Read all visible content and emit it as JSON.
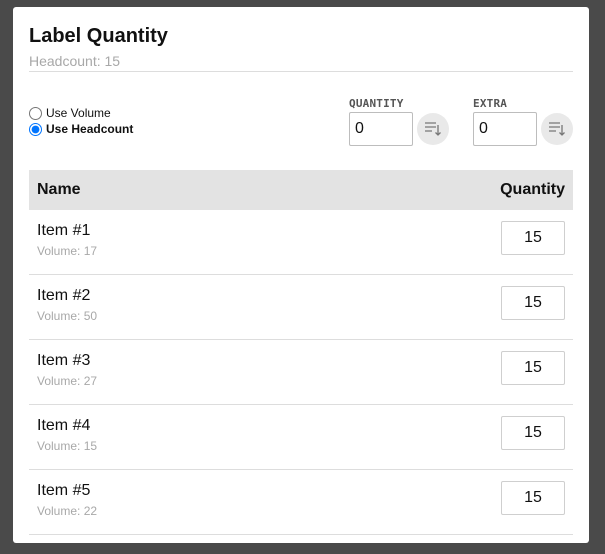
{
  "dialog": {
    "title": "Label Quantity",
    "subtitle": "Headcount: 15"
  },
  "mode": {
    "options": [
      {
        "label": "Use Volume",
        "selected": false
      },
      {
        "label": "Use Headcount",
        "selected": true
      }
    ]
  },
  "fields": {
    "quantity": {
      "label": "QUANTITY",
      "value": "0",
      "icon": "sort-icon"
    },
    "extra": {
      "label": "EXTRA",
      "value": "0",
      "icon": "sort-icon"
    }
  },
  "table": {
    "headers": {
      "name": "Name",
      "quantity": "Quantity"
    },
    "rows": [
      {
        "name": "Item #1",
        "volume": "Volume: 17",
        "quantity": "15"
      },
      {
        "name": "Item #2",
        "volume": "Volume: 50",
        "quantity": "15"
      },
      {
        "name": "Item #3",
        "volume": "Volume: 27",
        "quantity": "15"
      },
      {
        "name": "Item #4",
        "volume": "Volume: 15",
        "quantity": "15"
      },
      {
        "name": "Item #5",
        "volume": "Volume: 22",
        "quantity": "15"
      }
    ]
  },
  "colors": {
    "overlay": "#4a4a4a",
    "header_bg": "#e3e3e3",
    "muted_text": "#a8a8a8"
  }
}
